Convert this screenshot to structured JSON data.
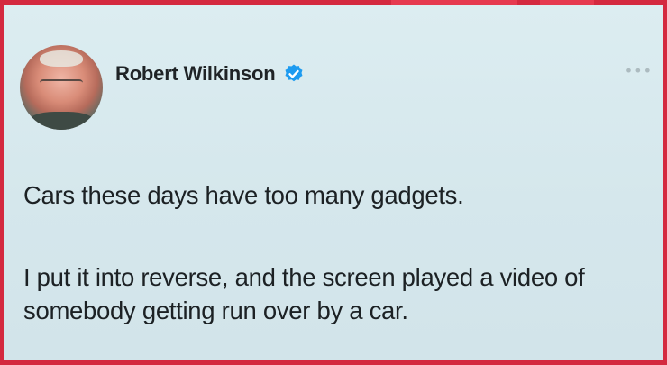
{
  "tweet": {
    "author": {
      "display_name": "Robert Wilkinson",
      "verified": true,
      "avatar_icon": "avatar-photo"
    },
    "paragraphs": [
      "Cars these days have too many gadgets.",
      "I put it into reverse, and the screen played a video of somebody getting run over by a car."
    ],
    "more_icon": "more-options-icon"
  },
  "colors": {
    "border": "#d4293f",
    "background": "#d8e8ec",
    "verified_badge": "#1d9bf0",
    "text": "#1c2124"
  }
}
